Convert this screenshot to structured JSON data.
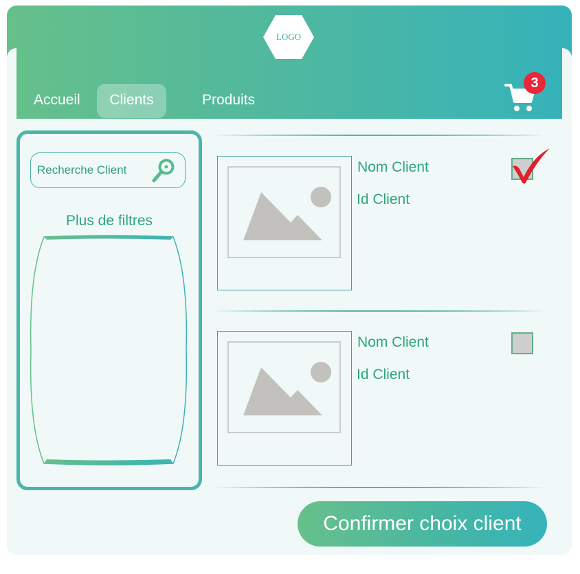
{
  "header": {
    "logo_text": "LOGO",
    "nav": [
      {
        "label": "Accueil"
      },
      {
        "label": "Clients"
      },
      {
        "label": "Produits"
      }
    ],
    "active_nav": "Clients",
    "cart_count": "3"
  },
  "sidebar": {
    "search_placeholder": "Recherche Client",
    "more_filters_label": "Plus de filtres"
  },
  "clients": [
    {
      "name": "Nom Client",
      "id": "Id Client",
      "checked": true
    },
    {
      "name": "Nom Client",
      "id": "Id Client",
      "checked": false
    }
  ],
  "confirm_label": "Confirmer choix client",
  "colors": {
    "gradient_start": "#66c08a",
    "gradient_end": "#35b2ba",
    "text_green": "#2ea57c",
    "badge_red": "#e8283a",
    "check_red": "#e0202e"
  }
}
